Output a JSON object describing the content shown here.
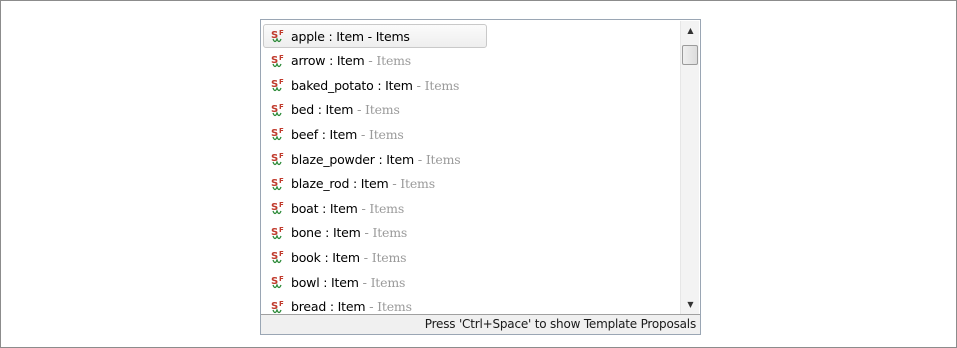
{
  "proposals": [
    {
      "name": "apple",
      "type": "Item",
      "category": "Items"
    },
    {
      "name": "arrow",
      "type": "Item",
      "category": "Items"
    },
    {
      "name": "baked_potato",
      "type": "Item",
      "category": "Items"
    },
    {
      "name": "bed",
      "type": "Item",
      "category": "Items"
    },
    {
      "name": "beef",
      "type": "Item",
      "category": "Items"
    },
    {
      "name": "blaze_powder",
      "type": "Item",
      "category": "Items"
    },
    {
      "name": "blaze_rod",
      "type": "Item",
      "category": "Items"
    },
    {
      "name": "boat",
      "type": "Item",
      "category": "Items"
    },
    {
      "name": "bone",
      "type": "Item",
      "category": "Items"
    },
    {
      "name": "book",
      "type": "Item",
      "category": "Items"
    },
    {
      "name": "bowl",
      "type": "Item",
      "category": "Items"
    },
    {
      "name": "bread",
      "type": "Item",
      "category": "Items"
    }
  ],
  "selected_index": 0,
  "icon": "static-field-icon",
  "status_text": "Press 'Ctrl+Space' to show Template Proposals",
  "colors": {
    "icon_red": "#c0392b",
    "icon_green": "#2e8b3a",
    "category_gray": "#9a9a9a"
  }
}
